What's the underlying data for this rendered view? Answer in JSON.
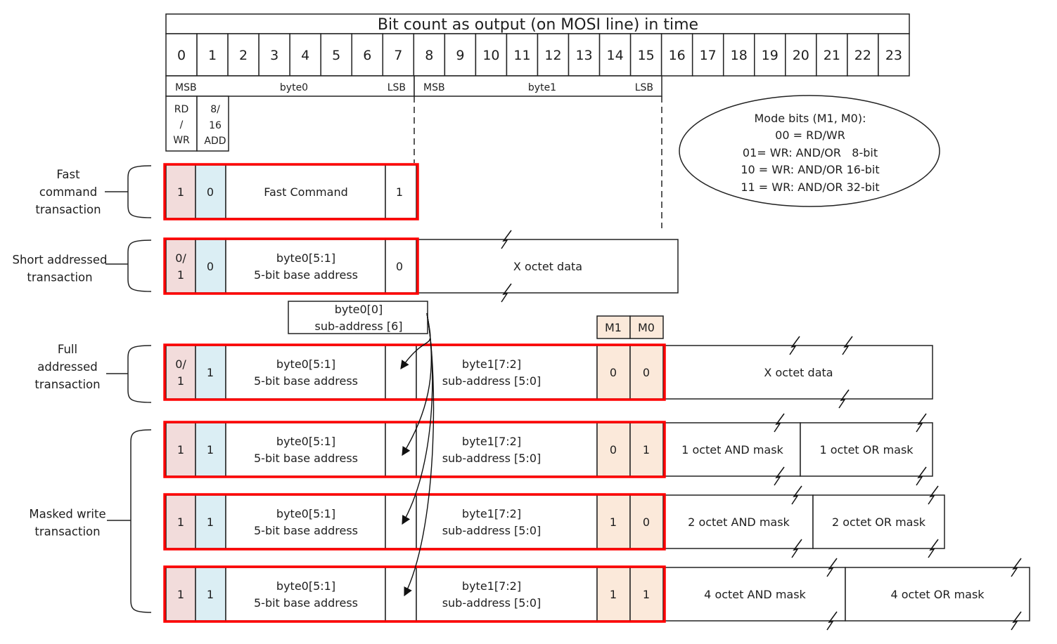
{
  "header": {
    "title": "Bit count as output (on MOSI line) in time",
    "bits": [
      "0",
      "1",
      "2",
      "3",
      "4",
      "5",
      "6",
      "7",
      "8",
      "9",
      "10",
      "11",
      "12",
      "13",
      "14",
      "15",
      "16",
      "17",
      "18",
      "19",
      "20",
      "21",
      "22",
      "23"
    ]
  },
  "byte_labels": [
    {
      "msb": "MSB",
      "name": "byte0",
      "lsb": "LSB"
    },
    {
      "msb": "MSB",
      "name": "byte1",
      "lsb": "LSB"
    }
  ],
  "field_legend": {
    "rdwr": [
      "RD",
      "/",
      "WR"
    ],
    "addr": [
      "8/",
      "16",
      "ADD"
    ]
  },
  "mode_legend": {
    "lines": [
      "Mode bits (M1, M0):",
      "00 = RD/WR",
      "01= WR: AND/OR   8-bit",
      "10 = WR: AND/OR 16-bit",
      "11 = WR: AND/OR 32-bit"
    ]
  },
  "mode_header": {
    "m1": "M1",
    "m0": "M0"
  },
  "subaddr_note": [
    "byte0[0]",
    "sub-address [6]"
  ],
  "colors": {
    "highlight_border": "#ff0000",
    "rdwr_fill": "#f2dcdb",
    "addr_fill": "#dbeef4",
    "mode_fill": "#fbe9da",
    "line": "#222222"
  },
  "groups": [
    {
      "label": [
        "Fast",
        "command",
        "transaction"
      ]
    },
    {
      "label": [
        "Short addressed",
        "transaction"
      ]
    },
    {
      "label": [
        "Full",
        "addressed",
        "transaction"
      ]
    },
    {
      "label": [
        "Masked write",
        "transaction"
      ]
    }
  ],
  "transactions": [
    {
      "type": "fast-command",
      "rdwr": [
        "1"
      ],
      "addr": "0",
      "body": [
        "Fast Command"
      ],
      "lsb": "1"
    },
    {
      "type": "short-addressed",
      "rdwr": [
        "0/",
        "1"
      ],
      "addr": "0",
      "body": [
        "byte0[5:1]",
        "5-bit base address"
      ],
      "lsb": "0",
      "data": [
        {
          "text": "X octet data"
        }
      ]
    },
    {
      "type": "full-addressed",
      "rdwr": [
        "0/",
        "1"
      ],
      "addr": "1",
      "body": [
        "byte0[5:1]",
        "5-bit base address"
      ],
      "lsb": "",
      "sub": [
        "byte1[7:2]",
        "sub-address [5:0]"
      ],
      "m1": "0",
      "m0": "0",
      "data": [
        {
          "text": "X octet data"
        }
      ]
    },
    {
      "type": "masked-write-8",
      "rdwr": [
        "1"
      ],
      "addr": "1",
      "body": [
        "byte0[5:1]",
        "5-bit base address"
      ],
      "lsb": "",
      "sub": [
        "byte1[7:2]",
        "sub-address [5:0]"
      ],
      "m1": "0",
      "m0": "1",
      "data": [
        {
          "text": "1 octet AND mask"
        },
        {
          "text": "1 octet OR mask"
        }
      ]
    },
    {
      "type": "masked-write-16",
      "rdwr": [
        "1"
      ],
      "addr": "1",
      "body": [
        "byte0[5:1]",
        "5-bit base address"
      ],
      "lsb": "",
      "sub": [
        "byte1[7:2]",
        "sub-address [5:0]"
      ],
      "m1": "1",
      "m0": "0",
      "data": [
        {
          "text": "2 octet AND mask"
        },
        {
          "text": "2 octet OR mask"
        }
      ]
    },
    {
      "type": "masked-write-32",
      "rdwr": [
        "1"
      ],
      "addr": "1",
      "body": [
        "byte0[5:1]",
        "5-bit base address"
      ],
      "lsb": "",
      "sub": [
        "byte1[7:2]",
        "sub-address [5:0]"
      ],
      "m1": "1",
      "m0": "1",
      "data": [
        {
          "text": "4 octet AND mask"
        },
        {
          "text": "4 octet OR mask"
        }
      ]
    }
  ]
}
